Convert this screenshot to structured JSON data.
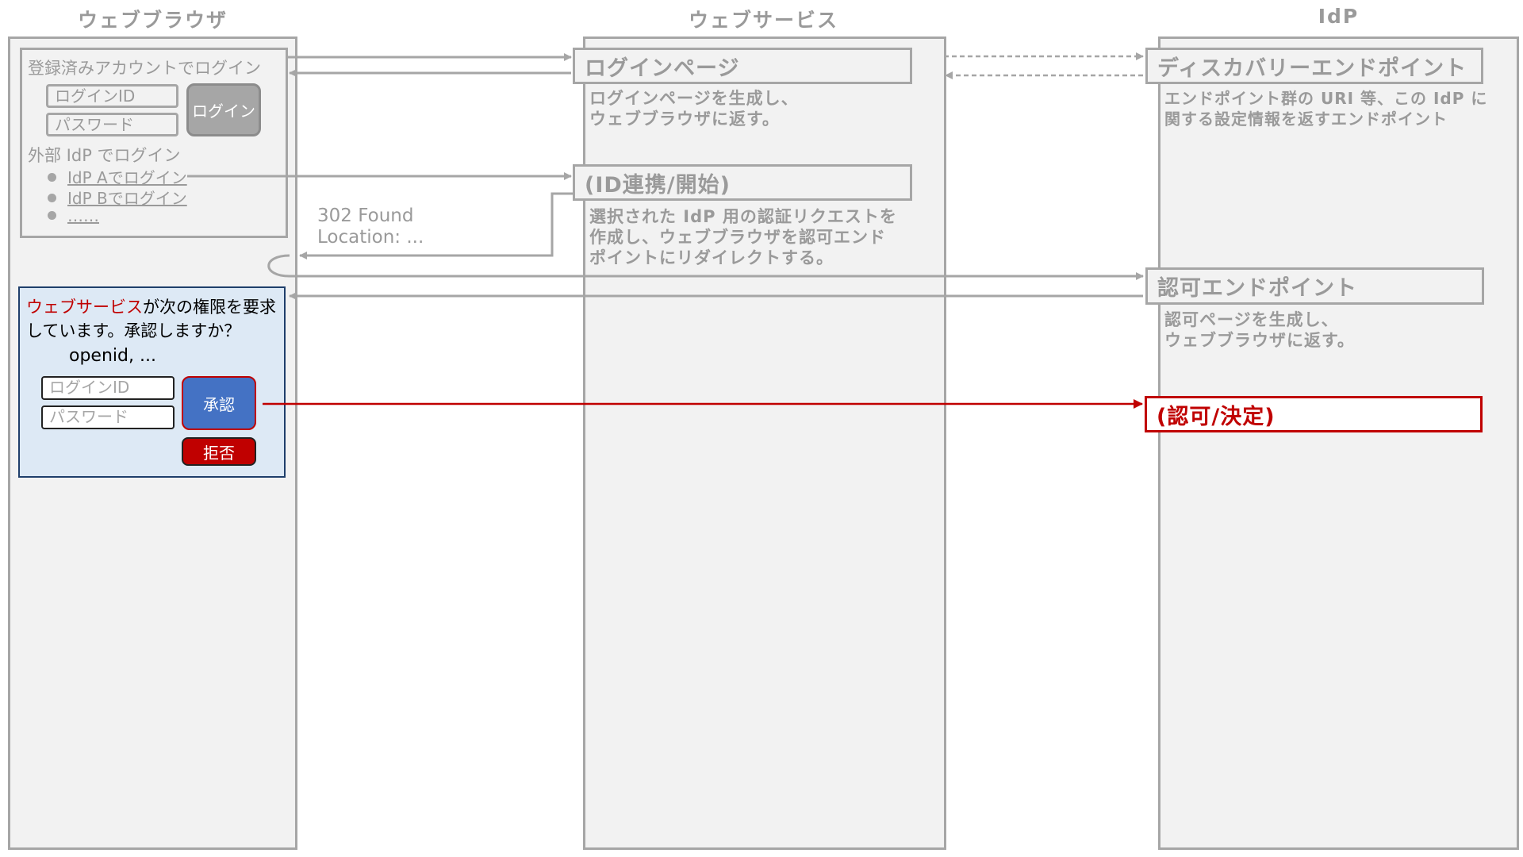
{
  "columns": {
    "browser": "ウェブブラウザ",
    "webservice": "ウェブサービス",
    "idp": "IdP"
  },
  "login_form": {
    "title": "登録済みアカウントでログイン",
    "login_id_placeholder": "ログインID",
    "password_placeholder": "パスワード",
    "login_button": "ログイン",
    "external_title": "外部 IdP でログイン",
    "external_items": [
      "IdP Aでログイン",
      "IdP Bでログイン",
      "……"
    ]
  },
  "redirect": {
    "status": "302 Found",
    "location": "Location: ..."
  },
  "consent_dialog": {
    "requester": "ウェブサービス",
    "message_line1_rest": "が次の権限を要求",
    "message_line2": "しています。承認しますか？",
    "scopes": "openid, ...",
    "login_id_placeholder": "ログインID",
    "password_placeholder": "パスワード",
    "approve_button": "承認",
    "deny_button": "拒否"
  },
  "webservice": {
    "login_page": {
      "title": "ログインページ",
      "description": [
        "ログインページを生成し、",
        "ウェブブラウザに返す。"
      ]
    },
    "id_federation": {
      "title": "(ID連携/開始)",
      "description": [
        "選択された IdP 用の認証リクエストを",
        "作成し、ウェブブラウザを認可エンド",
        "ポイントにリダイレクトする。"
      ]
    }
  },
  "idp": {
    "discovery": {
      "title": "ディスカバリーエンドポイント",
      "description": [
        "エンドポイント群の URI 等、この IdP に",
        "関する設定情報を返すエンドポイント"
      ]
    },
    "authorization": {
      "title": "認可エンドポイント",
      "description": [
        "認可ページを生成し、",
        "ウェブブラウザに返す。"
      ]
    },
    "decision": {
      "title": "(認可/決定)"
    }
  },
  "colors": {
    "lane_fill": "#f2f2f2",
    "lane_border": "#a6a6a6",
    "muted_text": "#9a9a9a",
    "highlight_red": "#c00000",
    "dialog_fill": "#dde9f5",
    "dialog_border": "#1f3f6b",
    "approve_fill": "#4472c4"
  }
}
